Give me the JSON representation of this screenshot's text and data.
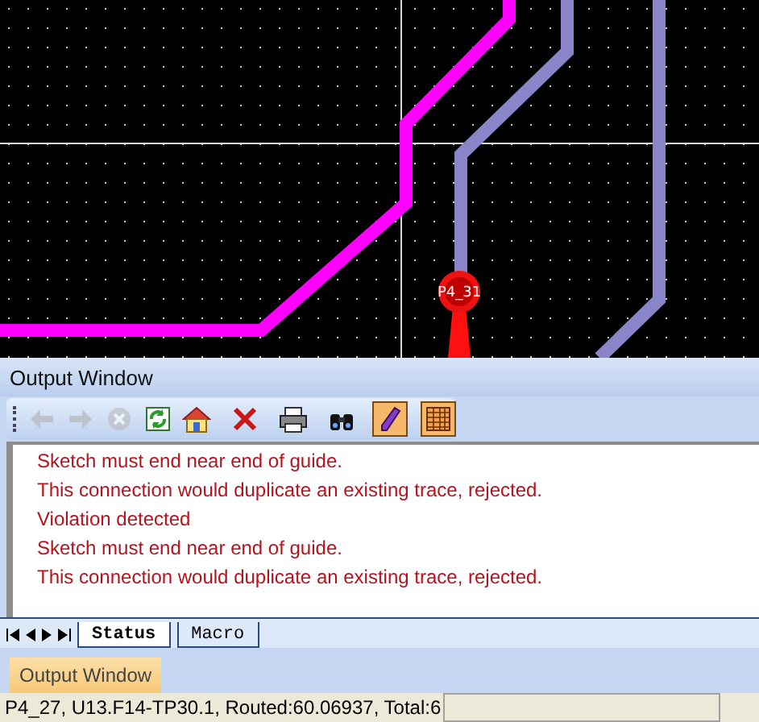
{
  "canvas": {
    "pad_label": "P4_31"
  },
  "output_window": {
    "title": "Output Window",
    "toolbar": [
      {
        "buttons": [
          {
            "kind": "back",
            "disabled": true,
            "on": false
          },
          {
            "kind": "forward",
            "disabled": true,
            "on": false
          },
          {
            "kind": "stop",
            "disabled": true,
            "on": false
          },
          {
            "kind": "refresh",
            "disabled": false,
            "on": false
          },
          {
            "kind": "home",
            "disabled": false,
            "on": false
          }
        ]
      },
      {
        "buttons": [
          {
            "kind": "delete",
            "disabled": false,
            "on": false
          }
        ]
      },
      {
        "buttons": [
          {
            "kind": "print",
            "disabled": false,
            "on": false
          }
        ]
      },
      {
        "buttons": [
          {
            "kind": "find",
            "disabled": false,
            "on": false
          }
        ]
      },
      {
        "buttons": [
          {
            "kind": "pencil",
            "disabled": false,
            "on": true
          }
        ]
      },
      {
        "buttons": [
          {
            "kind": "grid",
            "disabled": false,
            "on": true
          }
        ]
      }
    ],
    "messages": [
      "Sketch must end near end of guide.",
      "This connection would duplicate an existing trace, rejected.",
      "Violation detected",
      "Sketch must end near end of guide.",
      "This connection would duplicate an existing trace, rejected."
    ],
    "tabs": [
      {
        "label": "Status",
        "selected": true
      },
      {
        "label": "Macro",
        "selected": false
      }
    ]
  },
  "taskbar": {
    "label": "Output Window"
  },
  "status_bar": {
    "text": "P4_27, U13.F14-TP30.1, Routed:60.06937,  Total:6"
  }
}
